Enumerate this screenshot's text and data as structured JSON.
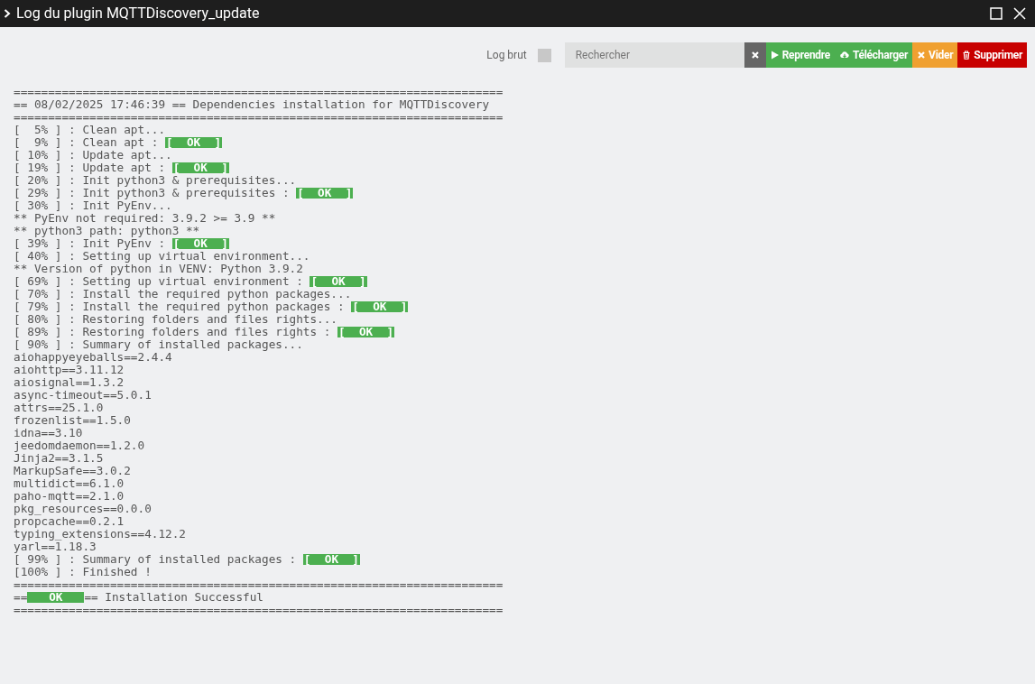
{
  "window": {
    "title": "Log du plugin MQTTDiscovery_update"
  },
  "toolbar": {
    "raw_log": {
      "label": "Log brut",
      "checked": false
    },
    "search": {
      "placeholder": "Rechercher"
    },
    "buttons": [
      {
        "kind": "clear"
      },
      {
        "kind": "resume",
        "label": "Reprendre"
      },
      {
        "kind": "download",
        "label": "Télécharger"
      },
      {
        "kind": "empty",
        "label": "Vider"
      },
      {
        "kind": "delete",
        "label": "Supprimer"
      }
    ]
  },
  "log": [
    {
      "text": "======================================================================="
    },
    {
      "text": "== 08/02/2025 17:46:39 == Dependencies installation for MQTTDiscovery"
    },
    {
      "text": "======================================================================="
    },
    {
      "text": "[  5% ] : Clean apt..."
    },
    {
      "text": "[  9% ] : Clean apt : ",
      "badge": "[  OK  ]"
    },
    {
      "text": "[ 10% ] : Update apt..."
    },
    {
      "text": "[ 19% ] : Update apt : ",
      "badge": "[  OK  ]"
    },
    {
      "text": "[ 20% ] : Init python3 & prerequisites..."
    },
    {
      "text": "[ 29% ] : Init python3 & prerequisites : ",
      "badge": "[  OK  ]"
    },
    {
      "text": "[ 30% ] : Init PyEnv..."
    },
    {
      "text": "** PyEnv not required: 3.9.2 >= 3.9 **"
    },
    {
      "text": "** python3 path: python3 **"
    },
    {
      "text": "[ 39% ] : Init PyEnv : ",
      "badge": "[  OK  ]"
    },
    {
      "text": "[ 40% ] : Setting up virtual environment..."
    },
    {
      "text": "** Version of python in VENV: Python 3.9.2"
    },
    {
      "text": "[ 69% ] : Setting up virtual environment : ",
      "badge": "[  OK  ]"
    },
    {
      "text": "[ 70% ] : Install the required python packages..."
    },
    {
      "text": "[ 79% ] : Install the required python packages : ",
      "badge": "[  OK  ]"
    },
    {
      "text": "[ 80% ] : Restoring folders and files rights..."
    },
    {
      "text": "[ 89% ] : Restoring folders and files rights : ",
      "badge": "[  OK  ]"
    },
    {
      "text": "[ 90% ] : Summary of installed packages..."
    },
    {
      "text": "aiohappyeyeballs==2.4.4"
    },
    {
      "text": "aiohttp==3.11.12"
    },
    {
      "text": "aiosignal==1.3.2"
    },
    {
      "text": "async-timeout==5.0.1"
    },
    {
      "text": "attrs==25.1.0"
    },
    {
      "text": "frozenlist==1.5.0"
    },
    {
      "text": "idna==3.10"
    },
    {
      "text": "jeedomdaemon==1.2.0"
    },
    {
      "text": "Jinja2==3.1.5"
    },
    {
      "text": "MarkupSafe==3.0.2"
    },
    {
      "text": "multidict==6.1.0"
    },
    {
      "text": "paho-mqtt==2.1.0"
    },
    {
      "text": "pkg_resources==0.0.0"
    },
    {
      "text": "propcache==0.2.1"
    },
    {
      "text": "typing_extensions==4.12.2"
    },
    {
      "text": "yarl==1.18.3"
    },
    {
      "text": "[ 99% ] : Summary of installed packages : ",
      "badge": "[  OK  ]"
    },
    {
      "text": "[100% ] : Finished !"
    },
    {
      "text": "======================================================================="
    },
    {
      "text": "==",
      "badge": "   OK   ",
      "after": "== Installation Successful"
    },
    {
      "text": "======================================================================="
    }
  ]
}
